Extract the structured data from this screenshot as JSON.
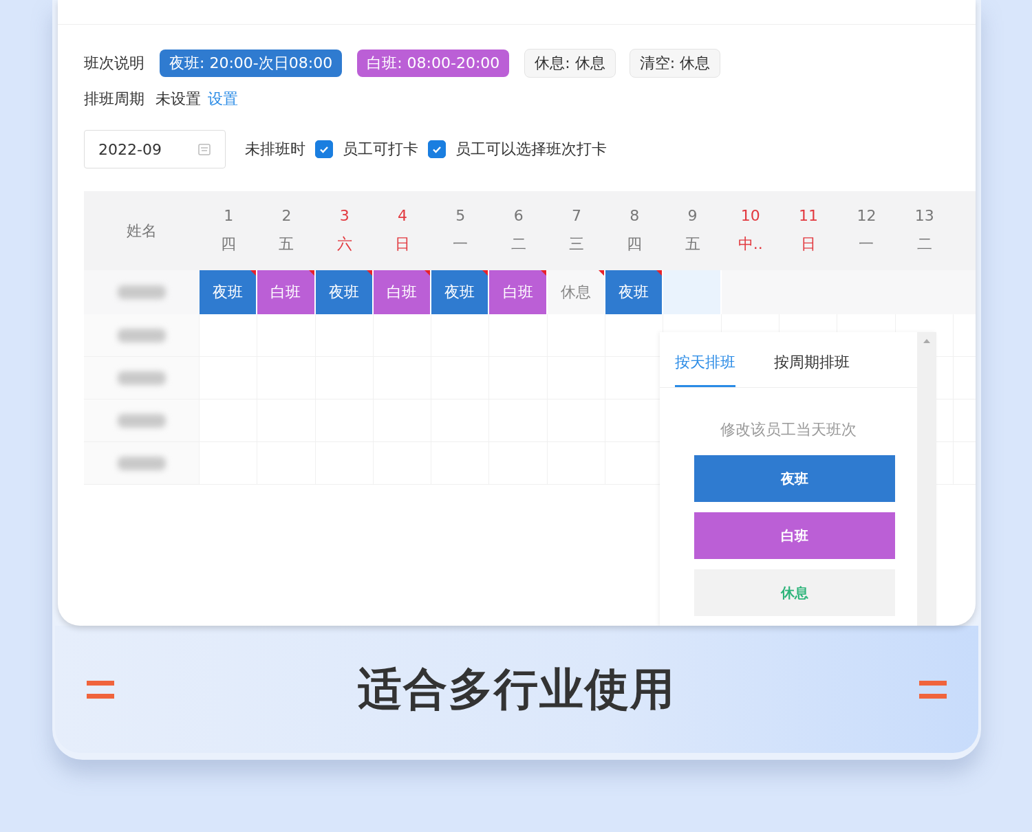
{
  "legend": {
    "label": "班次说明",
    "tags": [
      {
        "text": "夜班: 20:00-次日08:00",
        "kind": "night"
      },
      {
        "text": "白班: 08:00-20:00",
        "kind": "day"
      },
      {
        "text": "休息: 休息",
        "kind": "rest"
      },
      {
        "text": "清空: 休息",
        "kind": "rest"
      }
    ]
  },
  "cycle": {
    "label": "排班周期",
    "value": "未设置",
    "link": "设置"
  },
  "toolbar": {
    "month": "2022-09",
    "label": "未排班时",
    "checkboxes": [
      {
        "label": "员工可打卡",
        "checked": true
      },
      {
        "label": "员工可以选择班次打卡",
        "checked": true
      }
    ]
  },
  "table": {
    "name_header": "姓名",
    "days": [
      {
        "date": "1",
        "weekday": "四",
        "holiday": false
      },
      {
        "date": "2",
        "weekday": "五",
        "holiday": false
      },
      {
        "date": "3",
        "weekday": "六",
        "holiday": true
      },
      {
        "date": "4",
        "weekday": "日",
        "holiday": true
      },
      {
        "date": "5",
        "weekday": "一",
        "holiday": false
      },
      {
        "date": "6",
        "weekday": "二",
        "holiday": false
      },
      {
        "date": "7",
        "weekday": "三",
        "holiday": false
      },
      {
        "date": "8",
        "weekday": "四",
        "holiday": false
      },
      {
        "date": "9",
        "weekday": "五",
        "holiday": false
      },
      {
        "date": "10",
        "weekday": "中..",
        "holiday": true
      },
      {
        "date": "11",
        "weekday": "日",
        "holiday": true
      },
      {
        "date": "12",
        "weekday": "一",
        "holiday": false
      },
      {
        "date": "13",
        "weekday": "二",
        "holiday": false
      }
    ],
    "rows": [
      {
        "name_hidden": true,
        "cells": [
          {
            "text": "夜班",
            "kind": "night",
            "marked": true,
            "selected": false
          },
          {
            "text": "白班",
            "kind": "day",
            "marked": true,
            "selected": false
          },
          {
            "text": "夜班",
            "kind": "night",
            "marked": true,
            "selected": false
          },
          {
            "text": "白班",
            "kind": "day",
            "marked": true,
            "selected": false
          },
          {
            "text": "夜班",
            "kind": "night",
            "marked": true,
            "selected": false
          },
          {
            "text": "白班",
            "kind": "day",
            "marked": true,
            "selected": false
          },
          {
            "text": "休息",
            "kind": "rest",
            "marked": true,
            "selected": false
          },
          {
            "text": "夜班",
            "kind": "night",
            "marked": true,
            "selected": false
          },
          {
            "kind": "empty",
            "marked": false,
            "selected": true
          }
        ]
      },
      {
        "name_hidden": true
      },
      {
        "name_hidden": true
      },
      {
        "name_hidden": true
      },
      {
        "name_hidden": true
      }
    ]
  },
  "popup": {
    "tabs": [
      {
        "label": "按天排班",
        "selected": true
      },
      {
        "label": "按周期排班",
        "selected": false
      }
    ],
    "hint": "修改该员工当天班次",
    "options": [
      {
        "label": "夜班",
        "kind": "night"
      },
      {
        "label": "白班",
        "kind": "day"
      },
      {
        "label": "休息",
        "kind": "rest"
      }
    ]
  },
  "banner": {
    "title": "适合多行业使用"
  }
}
